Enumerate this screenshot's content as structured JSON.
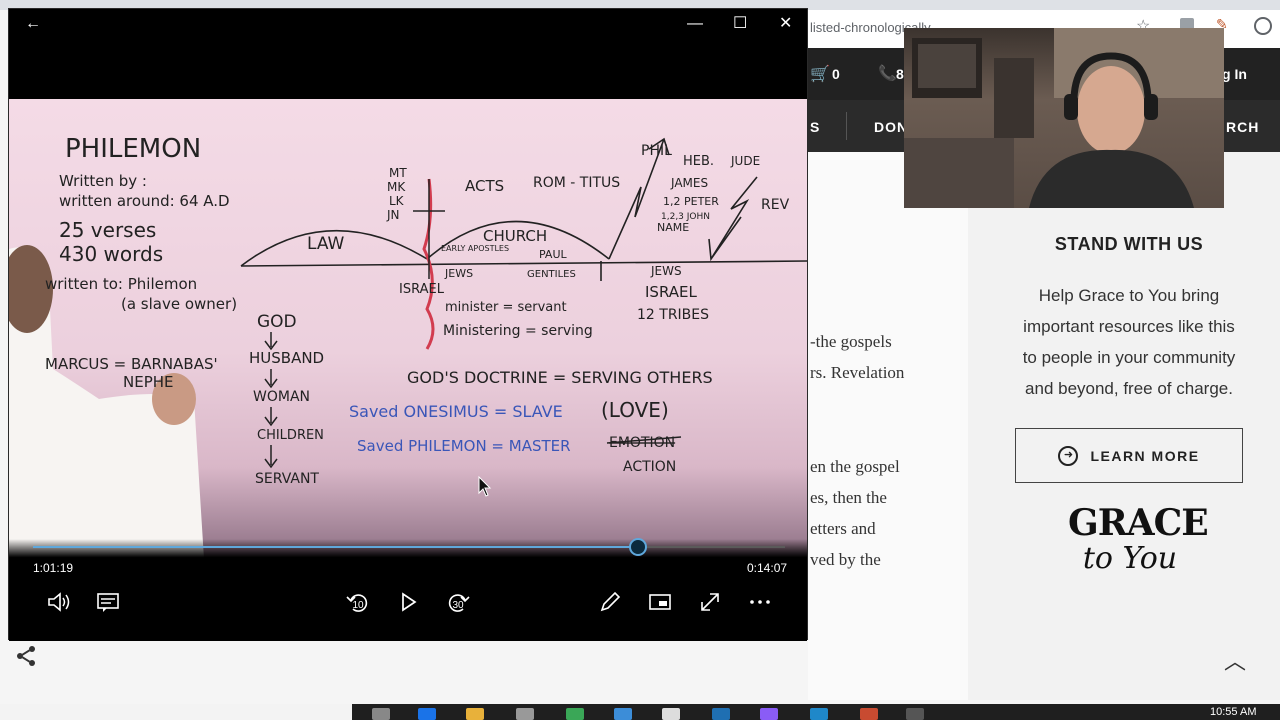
{
  "browser": {
    "url_fragment": "listed-chronologically"
  },
  "site": {
    "cart_count": "0",
    "phone_partial": "8",
    "login_partial": "g In",
    "nav": [
      "S",
      "DON",
      "RCH"
    ]
  },
  "article": {
    "lines": [
      "-the gospels",
      "rs. Revelation",
      "en the gospel",
      "es, then the",
      "etters and",
      "ved by the"
    ]
  },
  "sidebar": {
    "title": "STAND WITH US",
    "body_lines": [
      "Help Grace to You bring",
      "important resources like this",
      "to people in your community",
      "and beyond, free of charge."
    ],
    "learn_more_label": "LEARN MORE",
    "logo_top": "GRACE",
    "logo_bottom": "to You"
  },
  "player": {
    "progress": 0.805,
    "time_elapsed": "1:01:19",
    "time_remaining": "0:14:07",
    "skip_back_seconds": "10",
    "skip_forward_seconds": "30",
    "board": {
      "title": "PHILEMON",
      "left_notes": [
        "Written by :",
        "written around: 64 A.D",
        "25 verses",
        "430 words",
        "written to: Philemon",
        "(a slave owner)",
        "MARCUS = BARNABAS'",
        "NEPHE"
      ],
      "chain": [
        "GOD",
        "HUSBAND",
        "WOMAN",
        "CHILDREN",
        "SERVANT"
      ],
      "timeline": {
        "gospels": [
          "MT",
          "MK",
          "LK",
          "JN"
        ],
        "law": "LAW",
        "acts": "ACTS",
        "rom_titus": "ROM - TITUS",
        "church": "CHURCH",
        "early_apostles": "EARLY APOSTLES",
        "paul": "PAUL",
        "jews_left": "JEWS",
        "gentiles": "GENTILES",
        "israel_left": "ISRAEL",
        "phil": "PHIL",
        "heb": "HEB.",
        "jude": "JUDE",
        "james": "JAMES",
        "peter": "1,2 PETER",
        "john": "1,2,3 JOHN",
        "name": "NAME",
        "rev": "REV",
        "jews_right": "JEWS",
        "israel_right": "ISRAEL",
        "tribes": "12 TRIBES"
      },
      "minister_lines": [
        "minister = servant",
        "Ministering = serving"
      ],
      "doctrine": "GOD'S DOCTRINE  =  SERVING OTHERS",
      "onesimus": "Saved ONESIMUS = SLAVE",
      "philemon": "Saved PHILEMON = MASTER",
      "love": "(LOVE)",
      "emotion": "EMOTION",
      "action": "ACTION"
    }
  },
  "taskbar": {
    "clock": "10:55 AM"
  },
  "colors": {
    "accent": "#5fa8dc",
    "board_ink": "#222222",
    "board_blue": "#3a56b8",
    "board_red": "#d23c4f"
  }
}
